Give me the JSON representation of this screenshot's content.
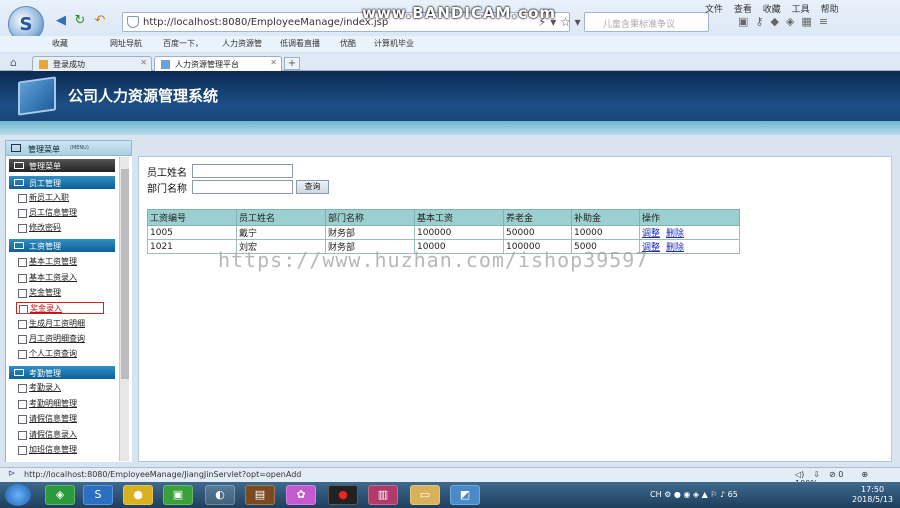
{
  "browser": {
    "url": "http://localhost:8080/EmployeeManage/index.jsp",
    "search_placeholder": "儿童含果标准争议",
    "watermark": "www.BANDICAM.com",
    "menu": [
      "文件",
      "查看",
      "收藏",
      "工具",
      "帮助"
    ],
    "bookmarks": [
      "收藏",
      "网址导航",
      "百度一下，",
      "人力资源管",
      "低调看直播",
      "优酷",
      "计算机毕业"
    ],
    "tabs": [
      {
        "label": "登录成功",
        "active": false
      },
      {
        "label": "人力资源管理平台",
        "active": true
      }
    ],
    "status_url": "http://localhost:8080/EmployeeManage/JiangJinServlet?opt=openAdd",
    "status_count": "0",
    "zoom": "100%"
  },
  "app": {
    "title": "公司人力资源管理系统",
    "menu_header": "管理菜单",
    "menu_header_sub": "(MENU)",
    "menu_header_sub2": "MENU"
  },
  "sidebar": {
    "top_section": "管理菜单",
    "sections": [
      {
        "title": "员工管理",
        "items": [
          "新员工入职",
          "员工信息管理",
          "修改密码"
        ]
      },
      {
        "title": "工资管理",
        "items": [
          "基本工资管理",
          "基本工资录入",
          "奖金管理",
          "奖金录入",
          "生成月工资明细",
          "月工资明细查询",
          "个人工资查询"
        ]
      },
      {
        "title": "考勤管理",
        "items": [
          "考勤录入",
          "考勤明细管理",
          "请假信息管理",
          "请假信息录入",
          "加班信息管理"
        ]
      }
    ],
    "selected_item": "奖金录入"
  },
  "search_form": {
    "employee_name_label": "员工姓名",
    "department_label": "部门名称",
    "query_button": "查询",
    "employee_name_value": "",
    "department_value": ""
  },
  "table": {
    "headers": [
      "工资编号",
      "员工姓名",
      "部门名称",
      "基本工资",
      "养老金",
      "补助金",
      "操作"
    ],
    "rows": [
      [
        "1005",
        "戴宁",
        "财务部",
        "100000",
        "50000",
        "10000"
      ],
      [
        "1021",
        "刘宏",
        "财务部",
        "10000",
        "100000",
        "5000"
      ]
    ],
    "actions": [
      "调整",
      "删除"
    ]
  },
  "overlay_watermark": "https://www.huzhan.com/ishop39597",
  "taskbar": {
    "lang": "CH",
    "time": "17:50",
    "date": "2018/5/13",
    "badge": "65"
  }
}
